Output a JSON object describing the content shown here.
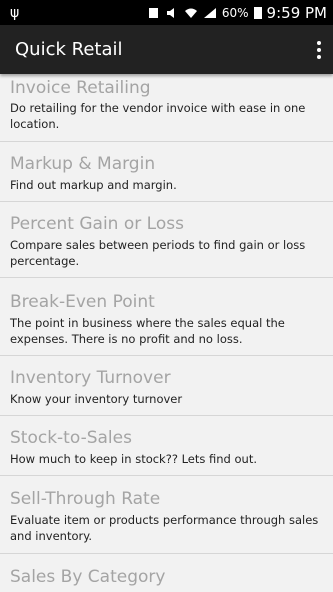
{
  "status_bar": {
    "usb_icon": "usb-icon",
    "battery_text": "60%",
    "time": "9:59 PM"
  },
  "app_bar": {
    "title": "Quick Retail"
  },
  "items": [
    {
      "title": "Invoice Retailing",
      "desc": "Do retailing for the vendor invoice with ease in one location."
    },
    {
      "title": "Markup & Margin",
      "desc": "Find out markup and margin."
    },
    {
      "title": "Percent Gain or Loss",
      "desc": "Compare sales between periods to find gain or loss percentage."
    },
    {
      "title": "Break-Even Point",
      "desc": "The point in business where the sales equal the expenses. There is no profit and no loss."
    },
    {
      "title": "Inventory Turnover",
      "desc": "Know your inventory turnover"
    },
    {
      "title": "Stock-to-Sales",
      "desc": "How much to keep in stock?? Lets find out."
    },
    {
      "title": "Sell-Through Rate",
      "desc": "Evaluate item or products performance through sales and inventory."
    },
    {
      "title": "Sales By Category",
      "desc": ""
    }
  ]
}
